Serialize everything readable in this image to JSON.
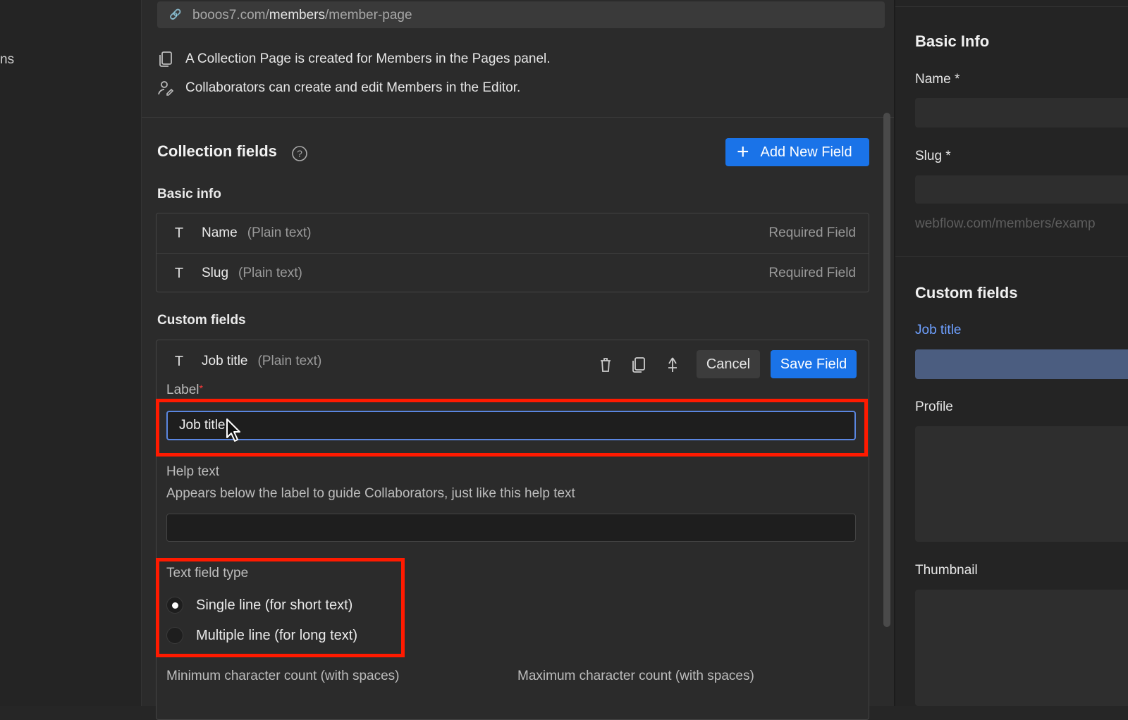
{
  "sidebar": {
    "fragment": "ns"
  },
  "url": {
    "prefix": "booos7.com/",
    "bold": "members",
    "suffix": "/member-page"
  },
  "info": {
    "line1": "A Collection Page is created for Members in the Pages panel.",
    "line2": "Collaborators can create and edit Members in the Editor."
  },
  "collection": {
    "title": "Collection fields",
    "add_button": "Add New Field",
    "basic_info_title": "Basic info",
    "basic_fields": [
      {
        "icon": "T",
        "name": "Name",
        "type": "(Plain text)",
        "status": "Required Field"
      },
      {
        "icon": "T",
        "name": "Slug",
        "type": "(Plain text)",
        "status": "Required Field"
      }
    ],
    "custom_fields_title": "Custom fields"
  },
  "editor": {
    "icon": "T",
    "name": "Job title",
    "type": "(Plain text)",
    "cancel_label": "Cancel",
    "save_label": "Save Field",
    "label_title": "Label",
    "label_required_mark": "*",
    "label_value": "Job title",
    "help_title": "Help text",
    "help_description": "Appears below the label to guide Collaborators, just like this help text",
    "help_value": "",
    "text_type_title": "Text field type",
    "options": [
      {
        "label": "Single line (for short text)",
        "selected": true
      },
      {
        "label": "Multiple line (for long text)",
        "selected": false
      }
    ],
    "min_label": "Minimum character count (with spaces)",
    "max_label": "Maximum character count (with spaces)"
  },
  "preview": {
    "basic_title": "Basic Info",
    "name_label": "Name *",
    "slug_label": "Slug *",
    "slug_hint": "webflow.com/members/examp",
    "custom_title": "Custom fields",
    "job_title_label": "Job title",
    "profile_label": "Profile",
    "thumbnail_label": "Thumbnail"
  },
  "colors": {
    "accent": "#1a73e8",
    "highlight": "#ff1a00",
    "focus_border": "#5a86e0"
  },
  "icons": [
    "link-icon",
    "pages-icon",
    "collaborators-icon",
    "help-icon",
    "plus-icon",
    "text-type-icon",
    "trash-icon",
    "duplicate-icon",
    "pin-icon",
    "mouse-cursor-icon"
  ]
}
